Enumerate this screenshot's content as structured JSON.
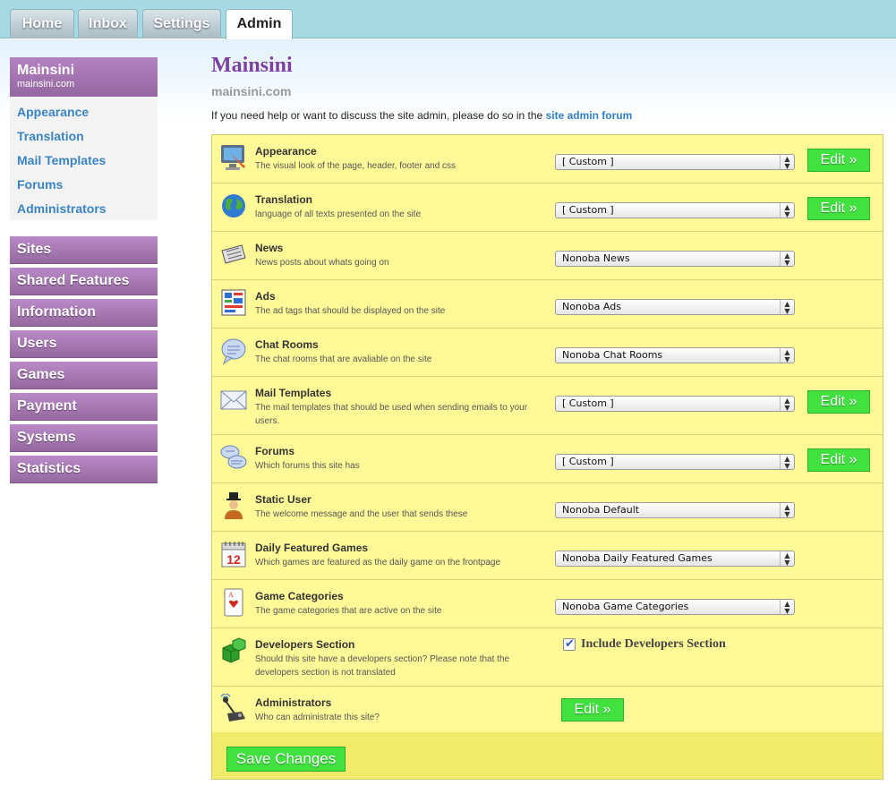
{
  "tabs": [
    {
      "label": "Home",
      "active": false
    },
    {
      "label": "Inbox",
      "active": false
    },
    {
      "label": "Settings",
      "active": false
    },
    {
      "label": "Admin",
      "active": true
    }
  ],
  "site": {
    "name": "Mainsini",
    "domain": "mainsini.com"
  },
  "site_links": [
    "Appearance",
    "Translation",
    "Mail Templates",
    "Forums",
    "Administrators"
  ],
  "nav": [
    "Sites",
    "Shared Features",
    "Information",
    "Users",
    "Games",
    "Payment",
    "Systems",
    "Statistics"
  ],
  "main": {
    "title": "Mainsini",
    "domain": "mainsini.com",
    "help_text": "If you need help or want to discuss the site admin, please do so in the",
    "help_link": "site admin forum"
  },
  "rows": [
    {
      "icon": "monitor-paint-icon",
      "name": "Appearance",
      "desc": "The visual look of the page, header, footer and css",
      "select": "[ Custom ]",
      "edit": "Edit »"
    },
    {
      "icon": "globe-icon",
      "name": "Translation",
      "desc": "language of all texts presented on the site",
      "select": "[ Custom ]",
      "edit": "Edit »"
    },
    {
      "icon": "newspaper-icon",
      "name": "News",
      "desc": "News posts about whats going on",
      "select": "Nonoba News",
      "edit": ""
    },
    {
      "icon": "ad-layout-icon",
      "name": "Ads",
      "desc": "The ad tags that should be displayed on the site",
      "select": "Nonoba Ads",
      "edit": ""
    },
    {
      "icon": "chat-bubble-icon",
      "name": "Chat Rooms",
      "desc": "The chat rooms that are avaliable on the site",
      "select": "Nonoba Chat Rooms",
      "edit": ""
    },
    {
      "icon": "envelope-icon",
      "name": "Mail Templates",
      "desc": "The mail templates that should be used when sending emails to your users.",
      "select": "[ Custom ]",
      "edit": "Edit »"
    },
    {
      "icon": "forum-bubbles-icon",
      "name": "Forums",
      "desc": "Which forums this site has",
      "select": "[ Custom ]",
      "edit": "Edit »"
    },
    {
      "icon": "user-top-hat-icon",
      "name": "Static User",
      "desc": "The welcome message and the user that sends these",
      "select": "Nonoba Default",
      "edit": ""
    },
    {
      "icon": "calendar-icon",
      "name": "Daily Featured Games",
      "desc": "Which games are featured as the daily game on the frontpage",
      "select": "Nonoba Daily Featured Games",
      "edit": ""
    },
    {
      "icon": "playing-card-icon",
      "name": "Game Categories",
      "desc": "The game categories that are active on the site",
      "select": "Nonoba Game Categories",
      "edit": ""
    },
    {
      "icon": "green-cubes-icon",
      "name": "Developers Section",
      "desc": "Should this site have a developers section? Please note that the developers section is not translated",
      "select": "",
      "edit": ""
    },
    {
      "icon": "joystick-icon",
      "name": "Administrators",
      "desc": "Who can administrate this site?",
      "select": "",
      "edit": "Edit »"
    }
  ],
  "developers_checkbox": {
    "label": "Include Developers Section",
    "checked": true
  },
  "save_label": "Save Changes",
  "calendar_number": "12",
  "card_symbol": "A"
}
